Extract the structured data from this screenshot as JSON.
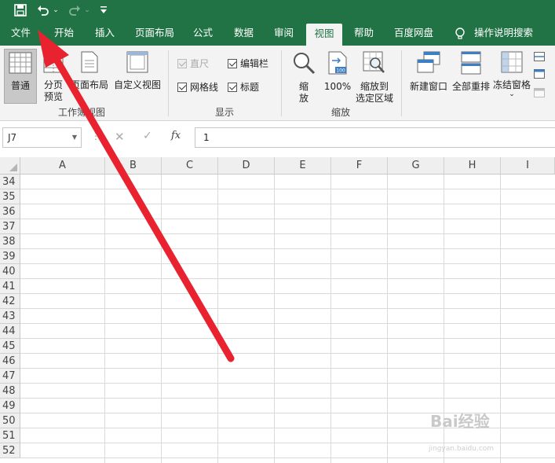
{
  "quick_access": {
    "save_icon": "save-icon",
    "undo_icon": "undo-icon",
    "redo_icon": "redo-icon",
    "customize_icon": "customize-qat-icon"
  },
  "tabs": [
    {
      "label": "文件"
    },
    {
      "label": "开始"
    },
    {
      "label": "插入"
    },
    {
      "label": "页面布局"
    },
    {
      "label": "公式"
    },
    {
      "label": "数据"
    },
    {
      "label": "审阅"
    },
    {
      "label": "视图",
      "active": true
    },
    {
      "label": "帮助"
    },
    {
      "label": "百度网盘"
    },
    {
      "label": "操作说明搜索"
    }
  ],
  "ribbon": {
    "workbook_views": {
      "label": "工作簿视图",
      "normal": "普通",
      "page_break_l1": "分页",
      "page_break_l2": "预览",
      "page_layout": "页面布局",
      "custom_views": "自定义视图"
    },
    "show": {
      "label": "显示",
      "ruler": "直尺",
      "formula_bar": "编辑栏",
      "gridlines": "网格线",
      "headings": "标题"
    },
    "zoom": {
      "label": "缩放",
      "zoom_l1": "缩",
      "zoom_l2": "放",
      "zoom_100": "100%",
      "zoom_sel_l1": "缩放到",
      "zoom_sel_l2": "选定区域"
    },
    "window": {
      "new_window": "新建窗口",
      "arrange_all": "全部重排",
      "freeze_panes": "冻结窗格"
    }
  },
  "formula_bar": {
    "name_box": "J7",
    "fx": "fx",
    "value": "1"
  },
  "grid": {
    "columns": [
      "A",
      "B",
      "C",
      "D",
      "E",
      "F",
      "G",
      "H",
      "I"
    ],
    "rows": [
      "34",
      "35",
      "36",
      "37",
      "38",
      "39",
      "40",
      "41",
      "42",
      "43",
      "44",
      "45",
      "46",
      "47",
      "48",
      "49",
      "50",
      "51",
      "52"
    ]
  },
  "watermark": {
    "text": "Bai经验",
    "url": "jingyan.baidu.com"
  },
  "annotation": {
    "color": "#e8232f"
  }
}
